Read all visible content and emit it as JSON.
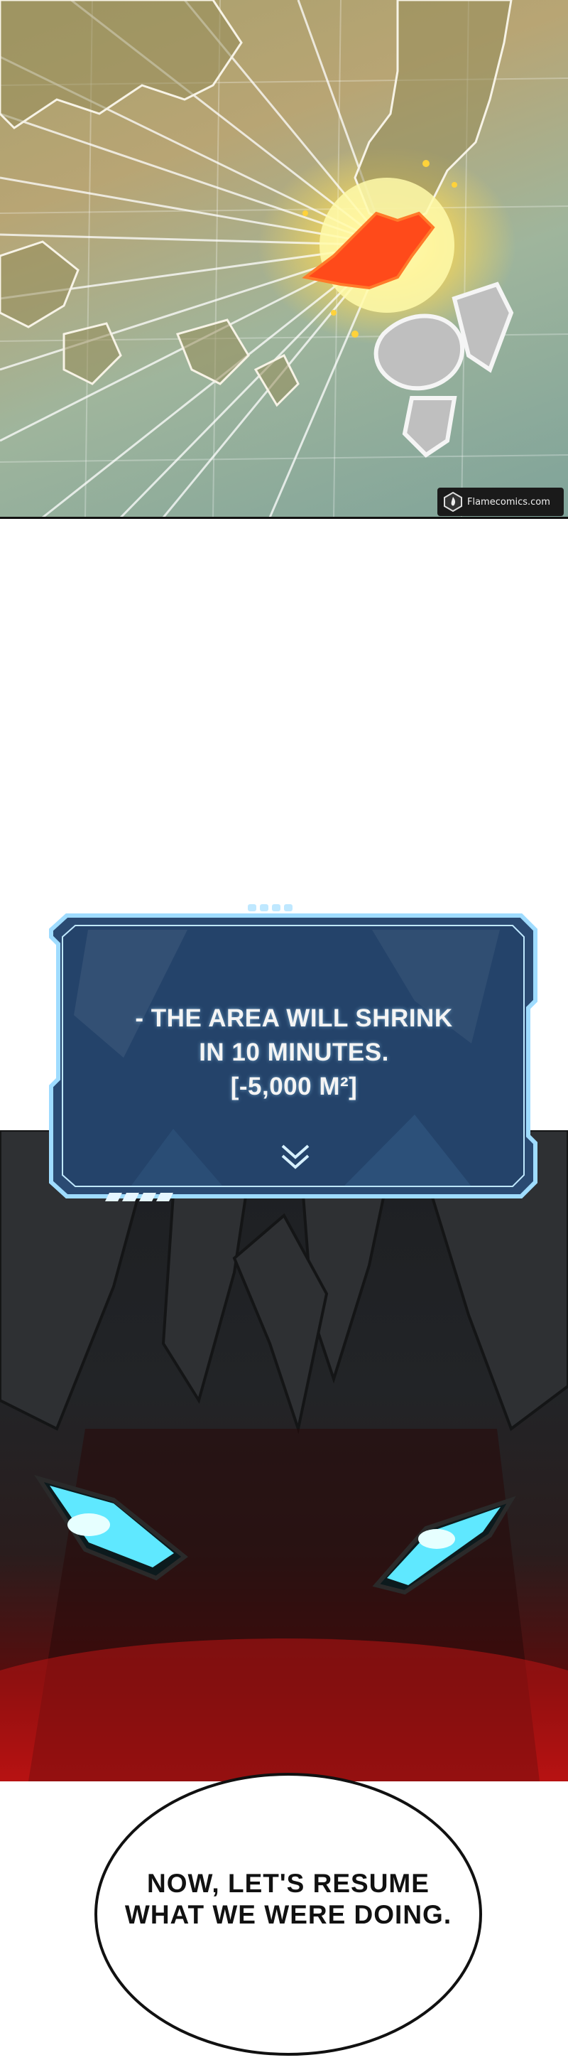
{
  "watermark": {
    "text": "Flamecomics.com",
    "logo_icon": "flame-logo-icon"
  },
  "system_message": {
    "lines": [
      "- THE AREA WILL SHRINK",
      "IN 10 MINUTES.",
      "[-5,000 M²]"
    ],
    "chevron_icon": "double-chevron-down-icon",
    "frame_color": "#7fd3ff",
    "panel_color": "#24436a"
  },
  "speech_bubble": {
    "lines": [
      "NOW, LET'S RESUME",
      "WHAT WE WERE DOING."
    ]
  },
  "colors": {
    "eye_glow": "#5fe8ff",
    "blood_red": "#b01010",
    "explosion": "#ff4a1a"
  }
}
